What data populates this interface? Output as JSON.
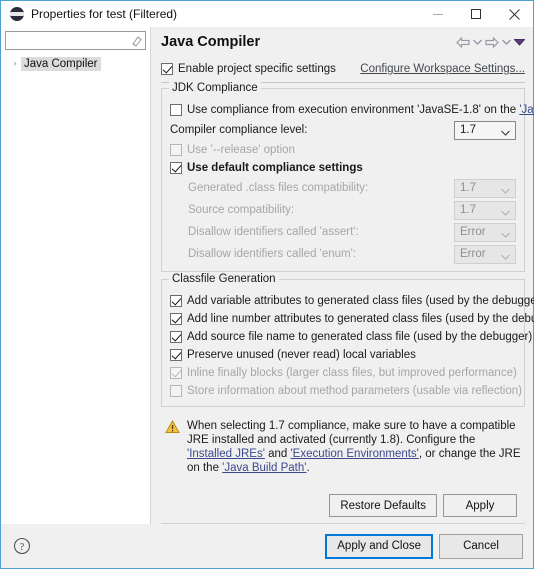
{
  "window": {
    "title": "Properties for test (Filtered)",
    "icon": "eclipse-icon",
    "minimize": "—",
    "maximize": "□",
    "close": "✕"
  },
  "sidebar": {
    "filter": {
      "value": "",
      "placeholder": "",
      "icon": "eraser-icon"
    },
    "tree": [
      {
        "label": "Java Compiler",
        "arrow": "›",
        "selected": true
      }
    ]
  },
  "header": {
    "title": "Java Compiler",
    "nav": [
      {
        "name": "back-arrow-icon"
      },
      {
        "name": "back-dropdown-icon"
      },
      {
        "name": "forward-arrow-icon"
      },
      {
        "name": "forward-dropdown-icon"
      },
      {
        "name": "view-menu-icon"
      }
    ]
  },
  "main": {
    "enable_project_specific": {
      "label": "Enable project specific settings",
      "checked": true
    },
    "configure_workspace_link": "Configure Workspace Settings...",
    "jdk_compliance": {
      "title": "JDK Compliance",
      "use_execution_environment": {
        "label_prefix": "Use compliance from execution environment 'JavaSE-1.8' on the ",
        "label_link": "'Java Build Path'",
        "checked": false,
        "enabled": true
      },
      "compliance_level": {
        "label": "Compiler compliance level:",
        "value": "1.7",
        "enabled": true
      },
      "use_release_option": {
        "label": "Use '--release' option",
        "checked": false,
        "enabled": false
      },
      "use_default_compliance": {
        "label": "Use default compliance settings",
        "checked": true,
        "enabled": true
      },
      "sub_settings": [
        {
          "label": "Generated .class files compatibility:",
          "value": "1.7",
          "enabled": false
        },
        {
          "label": "Source compatibility:",
          "value": "1.7",
          "enabled": false
        },
        {
          "label": "Disallow identifiers called 'assert':",
          "value": "Error",
          "enabled": false
        },
        {
          "label": "Disallow identifiers called 'enum':",
          "value": "Error",
          "enabled": false
        }
      ]
    },
    "classfile_generation": {
      "title": "Classfile Generation",
      "items": [
        {
          "label": "Add variable attributes to generated class files (used by the debugger)",
          "checked": true,
          "enabled": true
        },
        {
          "label": "Add line number attributes to generated class files (used by the debugger)",
          "checked": true,
          "enabled": true
        },
        {
          "label": "Add source file name to generated class file (used by the debugger)",
          "checked": true,
          "enabled": true
        },
        {
          "label": "Preserve unused (never read) local variables",
          "checked": true,
          "enabled": true
        },
        {
          "label": "Inline finally blocks (larger class files, but improved performance)",
          "checked": true,
          "enabled": false
        },
        {
          "label": "Store information about method parameters (usable via reflection)",
          "checked": false,
          "enabled": false
        }
      ]
    },
    "warning": {
      "icon": "warning-triangle-icon",
      "part1": "When selecting 1.7 compliance, make sure to have a compatible JRE installed and activated (currently 1.8). Configure the ",
      "link1": "'Installed JREs'",
      "part2": " and ",
      "link2": "'Execution Environments'",
      "part3": ", or change the JRE on the ",
      "link3": "'Java Build Path'",
      "part4": "."
    },
    "buttons": {
      "restore_defaults": "Restore Defaults",
      "apply": "Apply"
    }
  },
  "footer": {
    "help_icon": "help-question-icon",
    "apply_and_close": "Apply and Close",
    "cancel": "Cancel"
  },
  "colors": {
    "dialog_border": "#4ba3d3",
    "panel_bg": "#f0f0f0",
    "focus_blue": "#0078d7",
    "link": "#3a4a8c",
    "warning_amber": "#f0b429",
    "disabled_text": "#a6a6a6"
  }
}
